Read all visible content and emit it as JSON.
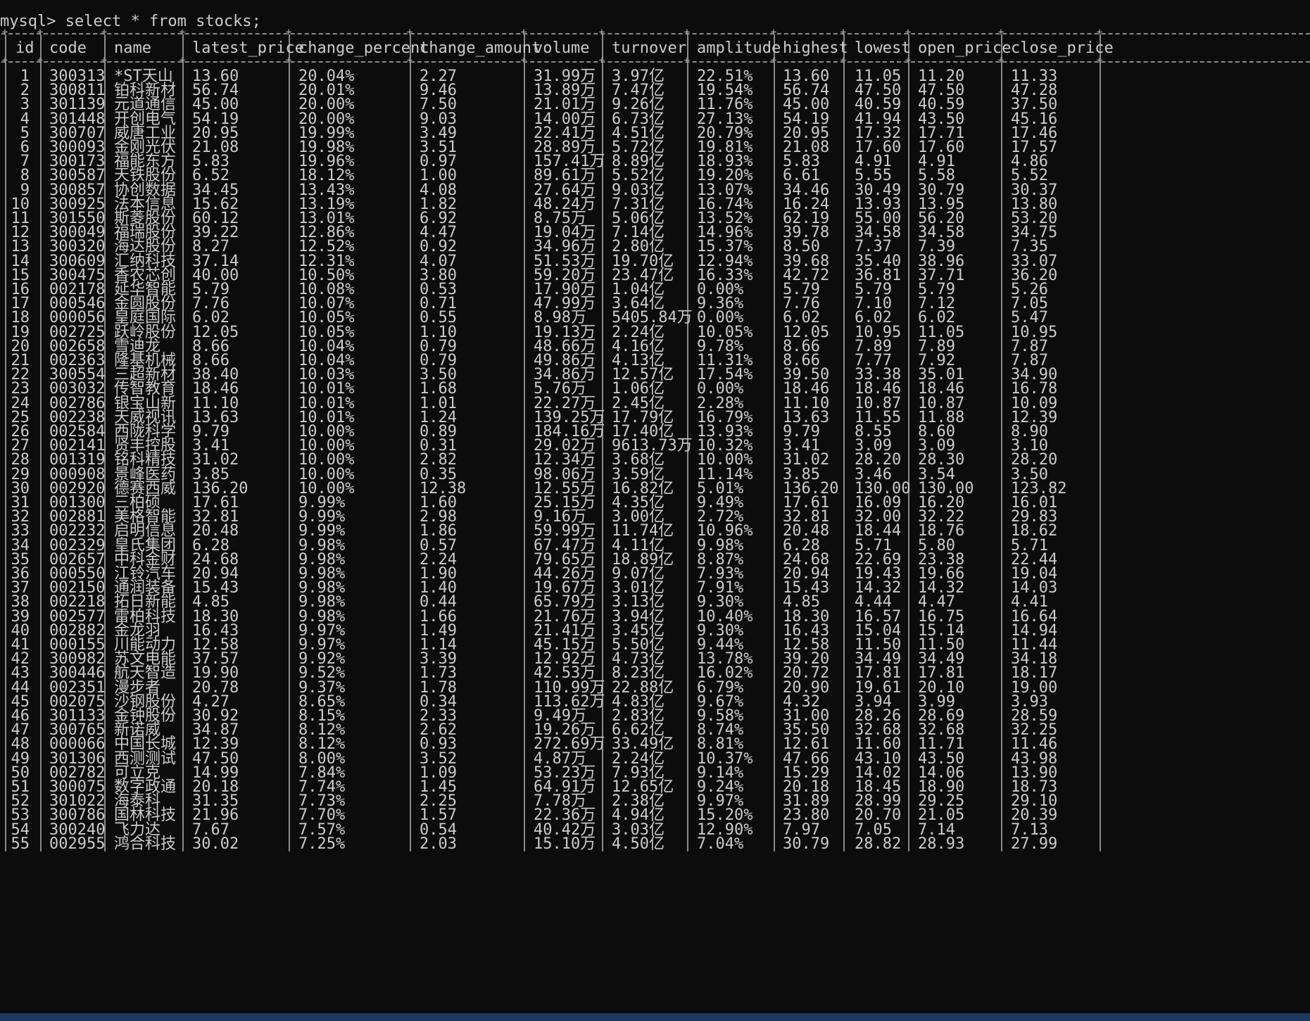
{
  "terminal": {
    "prompt": "mysql>",
    "command": "select * from stocks;"
  },
  "table": {
    "columns": [
      "id",
      "code",
      "name",
      "latest_price",
      "change_percent",
      "change_amount",
      "volume",
      "turnover",
      "amplitude",
      "highest",
      "lowest",
      "open_price",
      "close_price"
    ],
    "rows": [
      [
        "1",
        "300313",
        "*ST天山",
        "13.60",
        "20.04%",
        "2.27",
        "31.99万",
        "3.97亿",
        "22.51%",
        "13.60",
        "11.05",
        "11.20",
        "11.33"
      ],
      [
        "2",
        "300811",
        "铂科新材",
        "56.74",
        "20.01%",
        "9.46",
        "13.89万",
        "7.47亿",
        "19.54%",
        "56.74",
        "47.50",
        "47.50",
        "47.28"
      ],
      [
        "3",
        "301139",
        "元道通信",
        "45.00",
        "20.00%",
        "7.50",
        "21.01万",
        "9.26亿",
        "11.76%",
        "45.00",
        "40.59",
        "40.59",
        "37.50"
      ],
      [
        "4",
        "301448",
        "开创电气",
        "54.19",
        "20.00%",
        "9.03",
        "14.00万",
        "6.73亿",
        "27.13%",
        "54.19",
        "41.94",
        "43.50",
        "45.16"
      ],
      [
        "5",
        "300707",
        "威唐工业",
        "20.95",
        "19.99%",
        "3.49",
        "22.41万",
        "4.51亿",
        "20.79%",
        "20.95",
        "17.32",
        "17.71",
        "17.46"
      ],
      [
        "6",
        "300093",
        "金刚光伏",
        "21.08",
        "19.98%",
        "3.51",
        "28.89万",
        "5.72亿",
        "19.81%",
        "21.08",
        "17.60",
        "17.60",
        "17.57"
      ],
      [
        "7",
        "300173",
        "福能东方",
        "5.83",
        "19.96%",
        "0.97",
        "157.41万",
        "8.89亿",
        "18.93%",
        "5.83",
        "4.91",
        "4.91",
        "4.86"
      ],
      [
        "8",
        "300587",
        "天铁股份",
        "6.52",
        "18.12%",
        "1.00",
        "89.61万",
        "5.52亿",
        "19.20%",
        "6.61",
        "5.55",
        "5.58",
        "5.52"
      ],
      [
        "9",
        "300857",
        "协创数据",
        "34.45",
        "13.43%",
        "4.08",
        "27.64万",
        "9.03亿",
        "13.07%",
        "34.46",
        "30.49",
        "30.79",
        "30.37"
      ],
      [
        "10",
        "300925",
        "法本信息",
        "15.62",
        "13.19%",
        "1.82",
        "48.24万",
        "7.31亿",
        "16.74%",
        "16.24",
        "13.93",
        "13.95",
        "13.80"
      ],
      [
        "11",
        "301550",
        "斯菱股份",
        "60.12",
        "13.01%",
        "6.92",
        "8.75万",
        "5.06亿",
        "13.52%",
        "62.19",
        "55.00",
        "56.20",
        "53.20"
      ],
      [
        "12",
        "300049",
        "福瑞股份",
        "39.22",
        "12.86%",
        "4.47",
        "19.04万",
        "7.14亿",
        "14.96%",
        "39.78",
        "34.58",
        "34.58",
        "34.75"
      ],
      [
        "13",
        "300320",
        "海达股份",
        "8.27",
        "12.52%",
        "0.92",
        "34.96万",
        "2.80亿",
        "15.37%",
        "8.50",
        "7.37",
        "7.39",
        "7.35"
      ],
      [
        "14",
        "300609",
        "汇纳科技",
        "37.14",
        "12.31%",
        "4.07",
        "51.53万",
        "19.70亿",
        "12.94%",
        "39.68",
        "35.40",
        "38.96",
        "33.07"
      ],
      [
        "15",
        "300475",
        "香农芯创",
        "40.00",
        "10.50%",
        "3.80",
        "59.20万",
        "23.47亿",
        "16.33%",
        "42.72",
        "36.81",
        "37.71",
        "36.20"
      ],
      [
        "16",
        "002178",
        "延华智能",
        "5.79",
        "10.08%",
        "0.53",
        "17.90万",
        "1.04亿",
        "0.00%",
        "5.79",
        "5.79",
        "5.79",
        "5.26"
      ],
      [
        "17",
        "000546",
        "金圆股份",
        "7.76",
        "10.07%",
        "0.71",
        "47.99万",
        "3.64亿",
        "9.36%",
        "7.76",
        "7.10",
        "7.12",
        "7.05"
      ],
      [
        "18",
        "000056",
        "皇庭国际",
        "6.02",
        "10.05%",
        "0.55",
        "8.98万",
        "5405.84万",
        "0.00%",
        "6.02",
        "6.02",
        "6.02",
        "5.47"
      ],
      [
        "19",
        "002725",
        "跃岭股份",
        "12.05",
        "10.05%",
        "1.10",
        "19.13万",
        "2.24亿",
        "10.05%",
        "12.05",
        "10.95",
        "11.05",
        "10.95"
      ],
      [
        "20",
        "002658",
        "雪迪龙",
        "8.66",
        "10.04%",
        "0.79",
        "48.66万",
        "4.16亿",
        "9.78%",
        "8.66",
        "7.89",
        "7.89",
        "7.87"
      ],
      [
        "21",
        "002363",
        "隆基机械",
        "8.66",
        "10.04%",
        "0.79",
        "49.86万",
        "4.13亿",
        "11.31%",
        "8.66",
        "7.77",
        "7.92",
        "7.87"
      ],
      [
        "22",
        "300554",
        "三超新材",
        "38.40",
        "10.03%",
        "3.50",
        "34.86万",
        "12.57亿",
        "17.54%",
        "39.50",
        "33.38",
        "35.01",
        "34.90"
      ],
      [
        "23",
        "003032",
        "传智教育",
        "18.46",
        "10.01%",
        "1.68",
        "5.76万",
        "1.06亿",
        "0.00%",
        "18.46",
        "18.46",
        "18.46",
        "16.78"
      ],
      [
        "24",
        "002786",
        "银宝山新",
        "11.10",
        "10.01%",
        "1.01",
        "22.27万",
        "2.45亿",
        "2.28%",
        "11.10",
        "10.87",
        "10.87",
        "10.09"
      ],
      [
        "25",
        "002238",
        "天威视讯",
        "13.63",
        "10.01%",
        "1.24",
        "139.25万",
        "17.79亿",
        "16.79%",
        "13.63",
        "11.55",
        "11.88",
        "12.39"
      ],
      [
        "26",
        "002584",
        "西陇科学",
        "9.79",
        "10.00%",
        "0.89",
        "184.16万",
        "17.40亿",
        "13.93%",
        "9.79",
        "8.55",
        "8.60",
        "8.90"
      ],
      [
        "27",
        "002141",
        "贤丰控股",
        "3.41",
        "10.00%",
        "0.31",
        "29.02万",
        "9613.73万",
        "10.32%",
        "3.41",
        "3.09",
        "3.09",
        "3.10"
      ],
      [
        "28",
        "001319",
        "铭科精技",
        "31.02",
        "10.00%",
        "2.82",
        "12.34万",
        "3.68亿",
        "10.00%",
        "31.02",
        "28.20",
        "28.30",
        "28.20"
      ],
      [
        "29",
        "000908",
        "景峰医药",
        "3.85",
        "10.00%",
        "0.35",
        "98.06万",
        "3.59亿",
        "11.14%",
        "3.85",
        "3.46",
        "3.54",
        "3.50"
      ],
      [
        "30",
        "002920",
        "德赛西威",
        "136.20",
        "10.00%",
        "12.38",
        "12.55万",
        "16.82亿",
        "5.01%",
        "136.20",
        "130.00",
        "130.00",
        "123.82"
      ],
      [
        "31",
        "001300",
        "三柏硕",
        "17.61",
        "9.99%",
        "1.60",
        "25.15万",
        "4.35亿",
        "9.49%",
        "17.61",
        "16.09",
        "16.20",
        "16.01"
      ],
      [
        "32",
        "002881",
        "美格智能",
        "32.81",
        "9.99%",
        "2.98",
        "9.16万",
        "3.00亿",
        "2.72%",
        "32.81",
        "32.00",
        "32.22",
        "29.83"
      ],
      [
        "33",
        "002232",
        "启明信息",
        "20.48",
        "9.99%",
        "1.86",
        "59.99万",
        "11.74亿",
        "10.96%",
        "20.48",
        "18.44",
        "18.76",
        "18.62"
      ],
      [
        "34",
        "002329",
        "皇氏集团",
        "6.28",
        "9.98%",
        "0.57",
        "67.47万",
        "4.11亿",
        "9.98%",
        "6.28",
        "5.71",
        "5.80",
        "5.71"
      ],
      [
        "35",
        "002657",
        "中科金财",
        "24.68",
        "9.98%",
        "2.24",
        "79.65万",
        "18.89亿",
        "8.87%",
        "24.68",
        "22.69",
        "23.38",
        "22.44"
      ],
      [
        "36",
        "000550",
        "江铃汽车",
        "20.94",
        "9.98%",
        "1.90",
        "44.26万",
        "9.07亿",
        "7.93%",
        "20.94",
        "19.43",
        "19.66",
        "19.04"
      ],
      [
        "37",
        "002150",
        "通润装备",
        "15.43",
        "9.98%",
        "1.40",
        "19.67万",
        "3.01亿",
        "7.91%",
        "15.43",
        "14.32",
        "14.32",
        "14.03"
      ],
      [
        "38",
        "002218",
        "拓日新能",
        "4.85",
        "9.98%",
        "0.44",
        "65.79万",
        "3.13亿",
        "9.30%",
        "4.85",
        "4.44",
        "4.47",
        "4.41"
      ],
      [
        "39",
        "002577",
        "雷柏科技",
        "18.30",
        "9.98%",
        "1.66",
        "21.76万",
        "3.94亿",
        "10.40%",
        "18.30",
        "16.57",
        "16.75",
        "16.64"
      ],
      [
        "40",
        "002882",
        "金龙羽",
        "16.43",
        "9.97%",
        "1.49",
        "21.41万",
        "3.45亿",
        "9.30%",
        "16.43",
        "15.04",
        "15.14",
        "14.94"
      ],
      [
        "41",
        "000155",
        "川能动力",
        "12.58",
        "9.97%",
        "1.14",
        "45.15万",
        "5.50亿",
        "9.44%",
        "12.58",
        "11.50",
        "11.50",
        "11.44"
      ],
      [
        "42",
        "300982",
        "苏文电能",
        "37.57",
        "9.92%",
        "3.39",
        "12.92万",
        "4.73亿",
        "13.78%",
        "39.20",
        "34.49",
        "34.49",
        "34.18"
      ],
      [
        "43",
        "300446",
        "航天智造",
        "19.90",
        "9.52%",
        "1.73",
        "42.53万",
        "8.23亿",
        "16.02%",
        "20.72",
        "17.81",
        "17.81",
        "18.17"
      ],
      [
        "44",
        "002351",
        "漫步者",
        "20.78",
        "9.37%",
        "1.78",
        "110.99万",
        "22.88亿",
        "6.79%",
        "20.90",
        "19.61",
        "20.10",
        "19.00"
      ],
      [
        "45",
        "002075",
        "沙钢股份",
        "4.27",
        "8.65%",
        "0.34",
        "113.62万",
        "4.83亿",
        "9.67%",
        "4.32",
        "3.94",
        "3.99",
        "3.93"
      ],
      [
        "46",
        "301133",
        "金钟股份",
        "30.92",
        "8.15%",
        "2.33",
        "9.49万",
        "2.83亿",
        "9.58%",
        "31.00",
        "28.26",
        "28.69",
        "28.59"
      ],
      [
        "47",
        "300765",
        "新诺威",
        "34.87",
        "8.12%",
        "2.62",
        "19.26万",
        "6.62亿",
        "8.74%",
        "35.50",
        "32.68",
        "32.68",
        "32.25"
      ],
      [
        "48",
        "000066",
        "中国长城",
        "12.39",
        "8.12%",
        "0.93",
        "272.69万",
        "33.49亿",
        "8.81%",
        "12.61",
        "11.60",
        "11.71",
        "11.46"
      ],
      [
        "49",
        "301306",
        "西测测试",
        "47.50",
        "8.00%",
        "3.52",
        "4.87万",
        "2.24亿",
        "10.37%",
        "47.66",
        "43.10",
        "43.50",
        "43.98"
      ],
      [
        "50",
        "002782",
        "可立克",
        "14.99",
        "7.84%",
        "1.09",
        "53.23万",
        "7.93亿",
        "9.14%",
        "15.29",
        "14.02",
        "14.06",
        "13.90"
      ],
      [
        "51",
        "300075",
        "数字政通",
        "20.18",
        "7.74%",
        "1.45",
        "64.91万",
        "12.65亿",
        "9.24%",
        "20.18",
        "18.45",
        "18.90",
        "18.73"
      ],
      [
        "52",
        "301022",
        "海泰科",
        "31.35",
        "7.73%",
        "2.25",
        "7.78万",
        "2.38亿",
        "9.97%",
        "31.89",
        "28.99",
        "29.25",
        "29.10"
      ],
      [
        "53",
        "300786",
        "国林科技",
        "21.96",
        "7.70%",
        "1.57",
        "22.36万",
        "4.94亿",
        "15.20%",
        "23.80",
        "20.70",
        "21.05",
        "20.39"
      ],
      [
        "54",
        "300240",
        "飞力达",
        "7.67",
        "7.57%",
        "0.54",
        "40.42万",
        "3.03亿",
        "12.90%",
        "7.97",
        "7.05",
        "7.14",
        "7.13"
      ],
      [
        "55",
        "002955",
        "鸿合科技",
        "30.02",
        "7.25%",
        "2.03",
        "15.10万",
        "4.50亿",
        "7.04%",
        "30.79",
        "28.82",
        "28.93",
        "27.99"
      ]
    ]
  }
}
